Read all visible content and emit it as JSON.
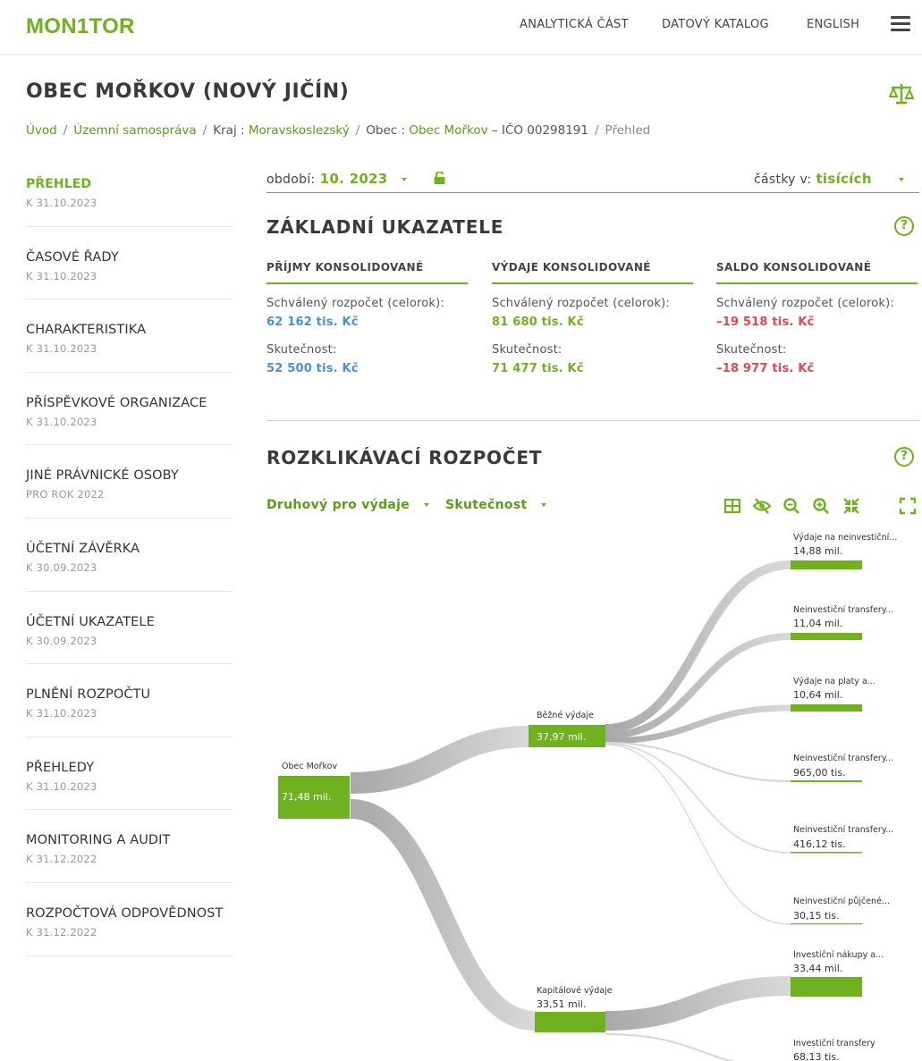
{
  "header": {
    "logo": "MON1TOR",
    "nav": [
      "ANALYTICKÁ ČÁST",
      "DATOVÝ KATALOG",
      "ENGLISH"
    ]
  },
  "page": {
    "title": "OBEC MOŘKOV (NOVÝ JIČÍN)"
  },
  "breadcrumb": {
    "home": "Úvod",
    "level1": "Územní samospráva",
    "kraj_label": "Kraj : ",
    "kraj_value": "Moravskoslezský",
    "obec_label": "Obec : ",
    "obec_value": "Obec Mořkov",
    "ico": " – IČO 00298191",
    "current": "Přehled"
  },
  "sidebar": {
    "items": [
      {
        "label": "PŘEHLED",
        "date": "K 31.10.2023"
      },
      {
        "label": "ČASOVÉ ŘADY",
        "date": "K 31.10.2023"
      },
      {
        "label": "CHARAKTERISTIKA",
        "date": "K 31.10.2023"
      },
      {
        "label": "PŘÍSPĚVKOVÉ ORGANIZACE",
        "date": "K 31.10.2023"
      },
      {
        "label": "JINÉ PRÁVNICKÉ OSOBY",
        "date": "PRO ROK 2022"
      },
      {
        "label": "ÚČETNÍ ZÁVĚRKA",
        "date": "K 30.09.2023"
      },
      {
        "label": "ÚČETNÍ UKAZATELE",
        "date": "K 30.09.2023"
      },
      {
        "label": "PLNĚNÍ ROZPOČTU",
        "date": "K 31.10.2023"
      },
      {
        "label": "PŘEHLEDY",
        "date": "K 31.10.2023"
      },
      {
        "label": "MONITORING A AUDIT",
        "date": "K 31.12.2022"
      },
      {
        "label": "ROZPOČTOVÁ ODPOVĚDNOST",
        "date": "K 31.12.2022"
      }
    ]
  },
  "filters": {
    "period_label": "období:",
    "period_value": "10. 2023",
    "amounts_label": "částky v:",
    "amounts_value": "tisících"
  },
  "basic": {
    "title": "ZÁKLADNÍ UKAZATELE",
    "help": "?",
    "columns": [
      {
        "header": "PŘÍJMY KONSOLIDOVANÉ",
        "budget_label": "Schválený rozpočet (celorok):",
        "budget_value": "62 162 tis. Kč",
        "actual_label": "Skutečnost:",
        "actual_value": "52 500 tis. Kč"
      },
      {
        "header": "VÝDAJE KONSOLIDOVANÉ",
        "budget_label": "Schválený rozpočet (celorok):",
        "budget_value": "81 680 tis. Kč",
        "actual_label": "Skutečnost:",
        "actual_value": "71 477 tis. Kč"
      },
      {
        "header": "SALDO KONSOLIDOVANÉ",
        "budget_label": "Schválený rozpočet (celorok):",
        "budget_value": "–19 518 tis. Kč",
        "actual_label": "Skutečnost:",
        "actual_value": "–18 977 tis. Kč"
      }
    ],
    "colors": {
      "income": "#4a90d9",
      "expense": "#6fb11f",
      "negative": "#e8444a",
      "accent": "#6fb11f"
    }
  },
  "budget": {
    "title": "ROZKLIKÁVACÍ ROZPOČET",
    "help": "?",
    "view_option": "Druhový pro výdaje",
    "measure_option": "Skutečnost",
    "tools": [
      "table-icon",
      "hide-icon",
      "zoom-out-icon",
      "zoom-in-icon",
      "collapse-icon",
      "fullscreen-icon"
    ]
  },
  "tree": {
    "root": {
      "name": "Obec Mořkov",
      "value": "71,48 mil."
    },
    "mid": [
      {
        "name": "Běžné výdaje",
        "value": "37,97 mil."
      },
      {
        "name": "Kapitálové výdaje",
        "value": "33,51 mil."
      }
    ],
    "leaves": [
      {
        "name": "Výdaje na neinvestiční...",
        "value": "14,88 mil."
      },
      {
        "name": "Neinvestiční transfery...",
        "value": "11,04 mil."
      },
      {
        "name": "Výdaje na platy a...",
        "value": "10,64 mil."
      },
      {
        "name": "Neinvestiční transfery...",
        "value": "965,00 tis."
      },
      {
        "name": "Neinvestiční transfery...",
        "value": "416,12 tis."
      },
      {
        "name": "Neinvestiční půjčené...",
        "value": "30,15 tis."
      },
      {
        "name": "Investiční nákupy a...",
        "value": "33,44 mil."
      },
      {
        "name": "Investiční transfery",
        "value": "68,13 tis."
      }
    ]
  }
}
